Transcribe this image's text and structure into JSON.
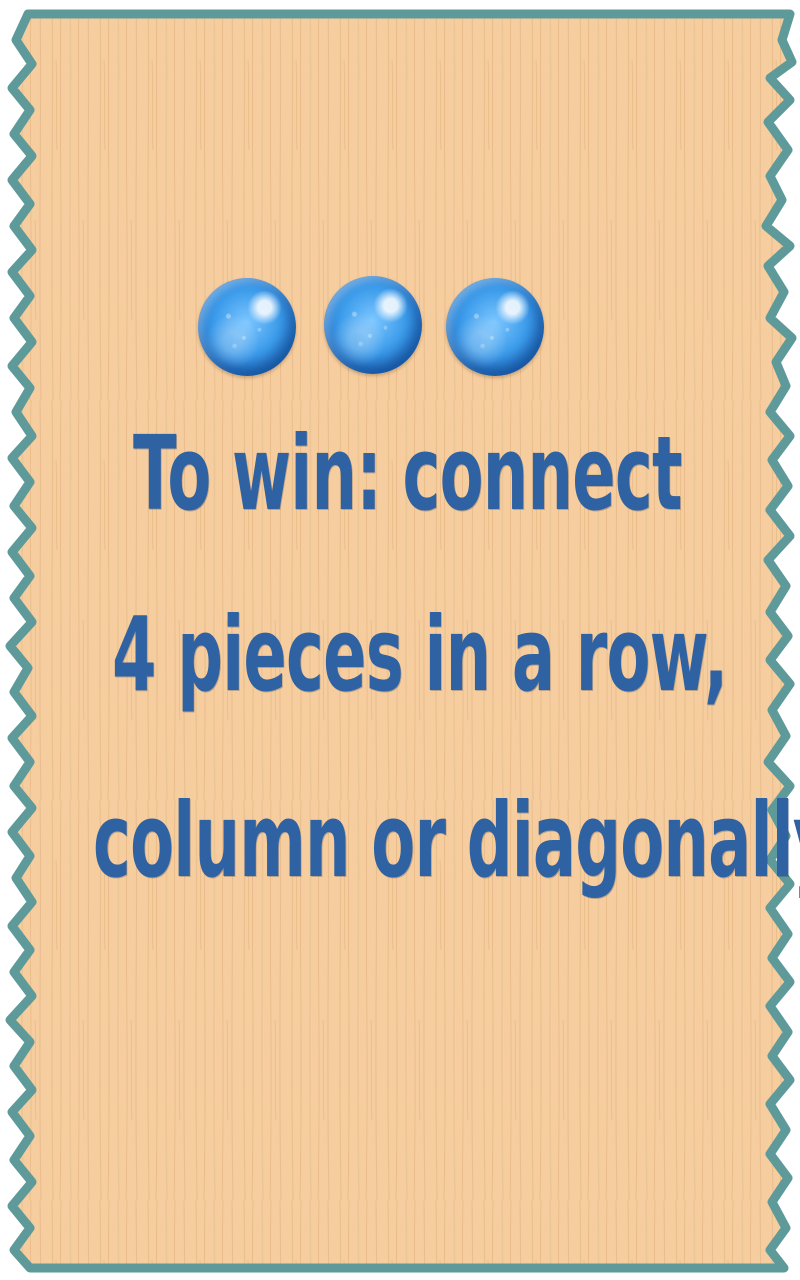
{
  "colors": {
    "wood_base": "#f6cd9e",
    "wood_grain": "#e0ad79",
    "board_border": "#5f9a9a",
    "text": "#2f62a2",
    "piece": "#3b9bea"
  },
  "pieces": [
    {
      "icon": "blue-piece-icon"
    },
    {
      "icon": "blue-piece-icon"
    },
    {
      "icon": "blue-piece-icon"
    }
  ],
  "instructions": {
    "line1": "To win: connect",
    "line2": "4 pieces in a row,",
    "line3": "column or diagonally"
  }
}
